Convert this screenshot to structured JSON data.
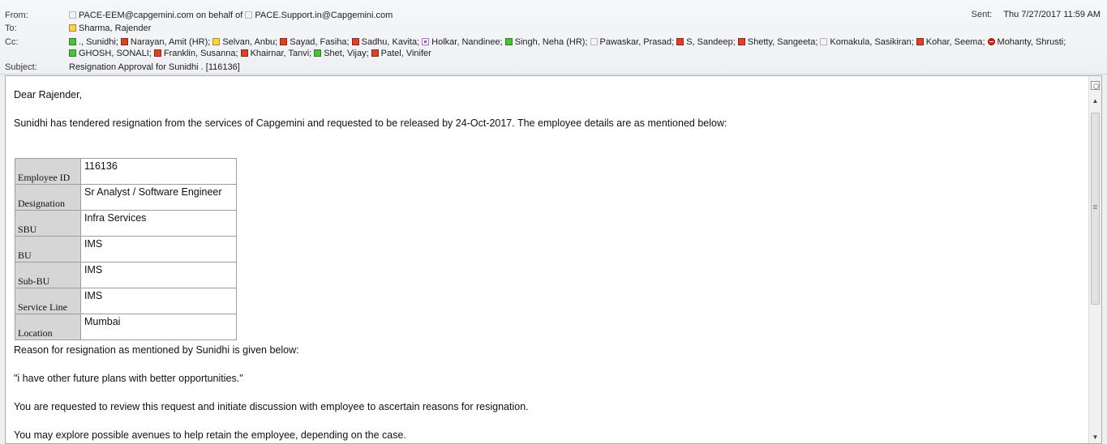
{
  "header": {
    "from_label": "From:",
    "from_sender": "PACE-EEM@capgemini.com",
    "from_behalf": "on behalf of",
    "from_mailbox": "PACE.Support.in@Capgemini.com",
    "sent_label": "Sent:",
    "sent_value": "Thu 7/27/2017 11:59 AM",
    "to_label": "To:",
    "to_recipient": "Sharma, Rajender",
    "cc_label": "Cc:",
    "cc_recipients": [
      {
        "name": "., Sunidhi;",
        "status": "available"
      },
      {
        "name": "Narayan, Amit (HR);",
        "status": "busy"
      },
      {
        "name": "Selvan, Anbu;",
        "status": "away"
      },
      {
        "name": "Sayad, Fasiha;",
        "status": "busy"
      },
      {
        "name": "Sadhu, Kavita;",
        "status": "busy"
      },
      {
        "name": "Holkar, Nandinee;",
        "status": "offline-purple"
      },
      {
        "name": "Singh, Neha (HR);",
        "status": "available"
      },
      {
        "name": "Pawaskar, Prasad;",
        "status": "unknown"
      },
      {
        "name": "S, Sandeep;",
        "status": "busy"
      },
      {
        "name": "Shetty, Sangeeta;",
        "status": "busy"
      },
      {
        "name": "Komakula, Sasikiran;",
        "status": "unknown"
      },
      {
        "name": "Kohar, Seema;",
        "status": "busy"
      },
      {
        "name": "Mohanty, Shrusti;",
        "status": "do-not-disturb"
      },
      {
        "name": "GHOSH, SONALI;",
        "status": "available"
      },
      {
        "name": "Franklin, Susanna;",
        "status": "busy"
      },
      {
        "name": "Khairnar, Tanvi;",
        "status": "busy"
      },
      {
        "name": "Shet, Vijay;",
        "status": "available"
      },
      {
        "name": "Patel, Vinifer",
        "status": "busy"
      }
    ],
    "subject_label": "Subject:",
    "subject_value": "Resignation Approval for Sunidhi . [116136]"
  },
  "body": {
    "greeting": "Dear Rajender,",
    "intro": "Sunidhi has tendered resignation from the services of Capgemini and requested to be released by 24-Oct-2017. The employee details are as mentioned below:",
    "details": [
      {
        "label": "Employee ID",
        "value": "116136"
      },
      {
        "label": "Designation",
        "value": "Sr Analyst / Software Engineer"
      },
      {
        "label": "SBU",
        "value": "Infra Services"
      },
      {
        "label": "BU",
        "value": "IMS"
      },
      {
        "label": "Sub-BU",
        "value": "IMS"
      },
      {
        "label": "Service Line",
        "value": "IMS"
      },
      {
        "label": "Location",
        "value": "Mumbai"
      }
    ],
    "reason_intro": "Reason for resignation as mentioned by Sunidhi is given below:",
    "reason": "\"i have other future plans with better opportunities.\"",
    "request": "You are requested to review this request and initiate discussion with employee to ascertain reasons for resignation.",
    "explore": "You may explore possible avenues to help retain the employee, depending on the case."
  },
  "status_colors": {
    "available": "#4cc23b",
    "busy": "#d8442a",
    "away": "#f3d54d",
    "do-not-disturb": "#c9251b",
    "unknown": "#f4f4f4",
    "offline-purple": "#8a5bb8"
  }
}
